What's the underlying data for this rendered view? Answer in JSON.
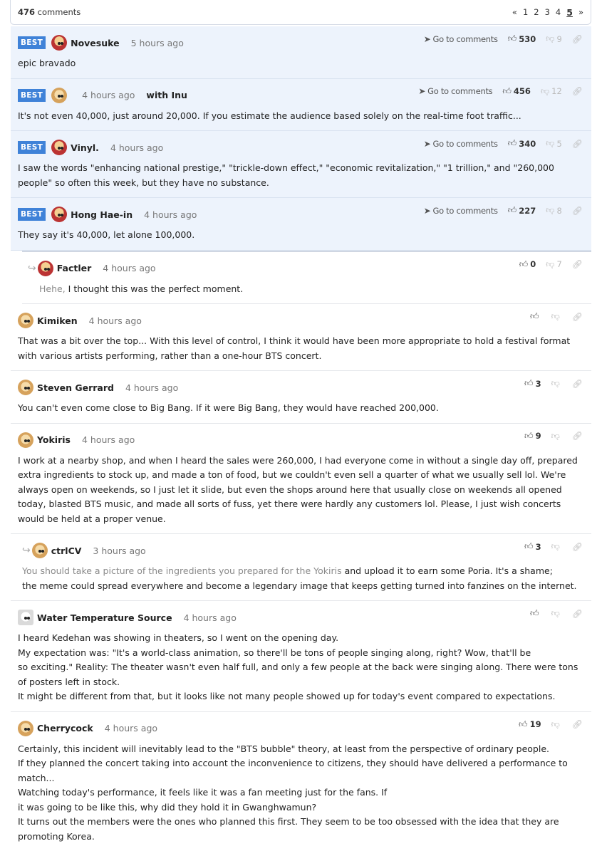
{
  "header": {
    "count_number": "476",
    "count_label": "comments",
    "pager": {
      "prev": "«",
      "pages": [
        "1",
        "2",
        "3",
        "4"
      ],
      "current": "5",
      "next": "»"
    }
  },
  "labels": {
    "best": "BEST",
    "go_to_comments": "Go to comments"
  },
  "comments": [
    {
      "author": "Novesuke",
      "time": "5 hours ago",
      "likes": "530",
      "dislikes": "9",
      "text": "epic bravado"
    },
    {
      "author": "",
      "time": "4 hours ago",
      "with": "with Inu",
      "likes": "456",
      "dislikes": "12",
      "text": "It's not even 40,000, just around 20,000. If you estimate the audience based solely on the real-time foot traffic..."
    },
    {
      "author": "Vinyl.",
      "time": "4 hours ago",
      "likes": "340",
      "dislikes": "5",
      "text": "I saw the words \"enhancing national prestige,\" \"trickle-down effect,\" \"economic revitalization,\" \"1 trillion,\" and \"260,000 people\" so often this week, but they have no substance."
    },
    {
      "author": "Hong Hae-in",
      "time": "4 hours ago",
      "likes": "227",
      "dislikes": "8",
      "text": "They say it's 40,000, let alone 100,000."
    },
    {
      "author": "Factler",
      "time": "4 hours ago",
      "likes": "0",
      "dislikes": "7",
      "quote": "Hehe,",
      "text": " I thought this was the perfect moment."
    },
    {
      "author": "Kimiken",
      "time": "4 hours ago",
      "likes": "",
      "dislikes": "",
      "text": "That was a bit over the top... With this level of control, I think it would have been more appropriate to hold a festival format with various artists performing, rather than a one-hour BTS concert."
    },
    {
      "author": "Steven Gerrard",
      "time": "4 hours ago",
      "likes": "3",
      "dislikes": "",
      "text": "You can't even come close to Big Bang. If it were Big Bang, they would have reached 200,000."
    },
    {
      "author": "Yokiris",
      "time": "4 hours ago",
      "likes": "9",
      "dislikes": "",
      "text": "I work at a nearby shop, and when I heard the sales were 260,000, I had everyone come in without a single day off, prepared extra ingredients to stock up, and made a ton of food, but we couldn't even sell a quarter of what we usually sell lol. We're always open on weekends, so I just let it slide, but even the shops around here that usually close on weekends all opened today, blasted BTS music, and made all sorts of fuss, yet there were hardly any customers lol. Please, I just wish concerts would be held at a proper venue."
    },
    {
      "author": "ctrlCV",
      "time": "3 hours ago",
      "likes": "3",
      "dislikes": "",
      "quote": "You should take a picture of the ingredients you prepared for the Yokiris",
      "text": " and upload it to earn some Poria. It's a shame;\nthe meme could spread everywhere and become a legendary image that keeps getting turned into fanzines on the internet."
    },
    {
      "author": "Water Temperature Source",
      "time": "4 hours ago",
      "likes": "",
      "dislikes": "",
      "text": "I heard Kedehan was showing in theaters, so I went on the opening day.\nMy expectation was: \"It's a world-class animation, so there'll be tons of people singing along, right? Wow, that'll be\nso exciting.\" Reality: The theater wasn't even half full, and only a few people at the back were singing along. There were tons of posters left in stock.\nIt might be different from that, but it looks like not many people showed up for today's event compared to expectations."
    },
    {
      "author": "Cherrycock",
      "time": "4 hours ago",
      "likes": "19",
      "dislikes": "",
      "text": "Certainly, this incident will inevitably lead to the \"BTS bubble\" theory, at least from the perspective of ordinary people.\nIf they planned the concert taking into account the inconvenience to citizens, they should have delivered a performance to match...\nWatching today's performance, it feels like it was a fan meeting just for the fans. If\nit was going to be like this, why did they hold it in Gwanghwamun?\nIt turns out the members were the ones who planned this first. They seem to be too obsessed with the idea that they are promoting Korea."
    }
  ]
}
